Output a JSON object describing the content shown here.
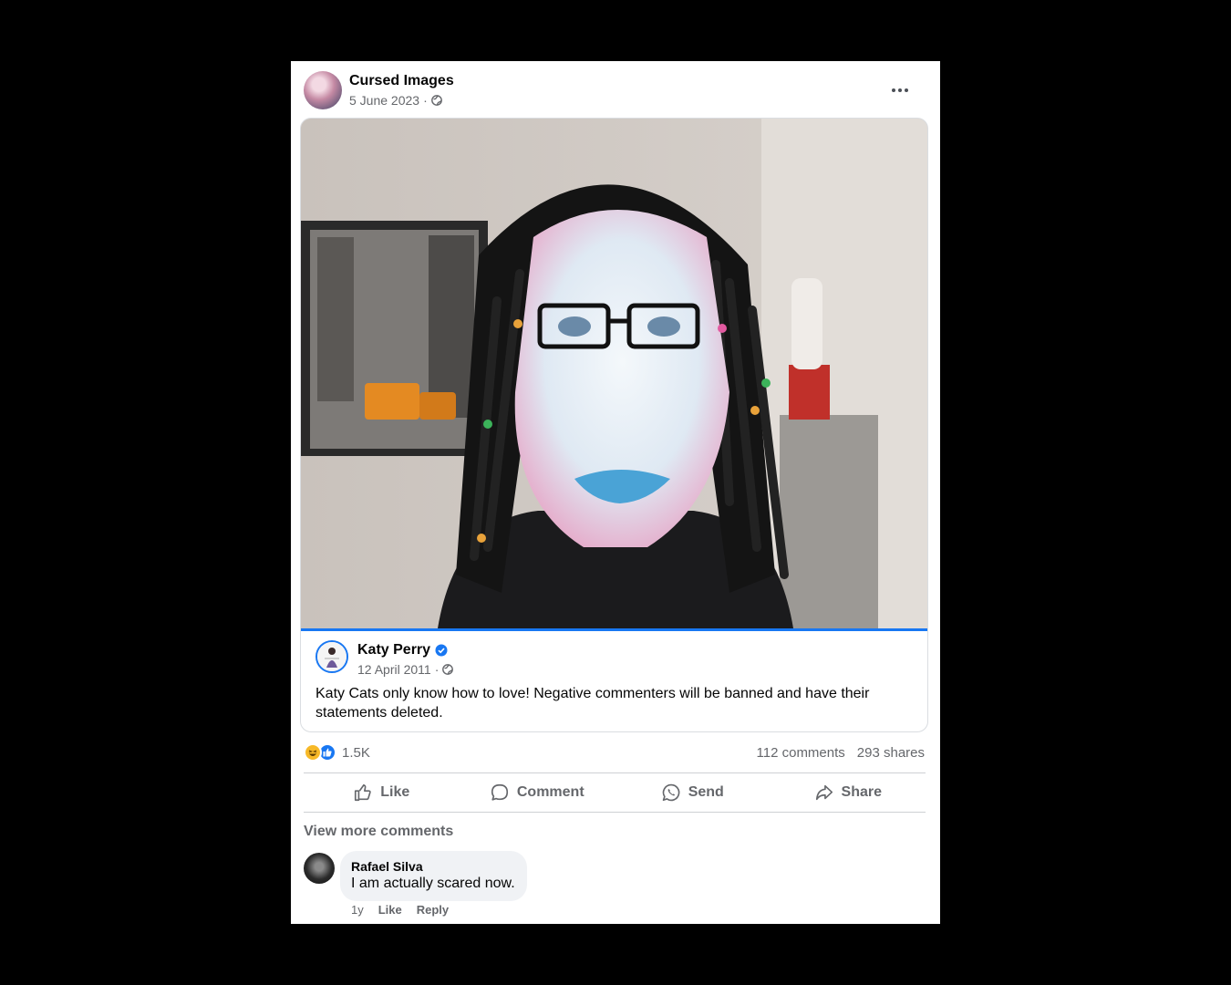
{
  "post": {
    "page_name": "Cursed Images",
    "date": "5 June 2023",
    "separator": "·",
    "privacy_icon": "globe-icon",
    "more_icon": "more-options-icon"
  },
  "shared": {
    "author": "Katy Perry",
    "verified_icon": "verified-badge-icon",
    "date": "12 April 2011",
    "separator": "·",
    "text": "Katy Cats only know how to love! Negative commenters will be banned and have their statements deleted."
  },
  "stats": {
    "reactions": [
      "haha",
      "like"
    ],
    "reaction_count": "1.5K",
    "comments": "112 comments",
    "shares": "293 shares"
  },
  "actions": {
    "like": "Like",
    "comment": "Comment",
    "send": "Send",
    "share": "Share"
  },
  "comments": {
    "view_more": "View more comments",
    "items": [
      {
        "author": "Rafael Silva",
        "text": "I am actually scared now.",
        "time": "1y",
        "like": "Like",
        "reply": "Reply"
      }
    ]
  },
  "colors": {
    "accent": "#1877f2",
    "secondary_text": "#65676b",
    "background": "#000000"
  }
}
